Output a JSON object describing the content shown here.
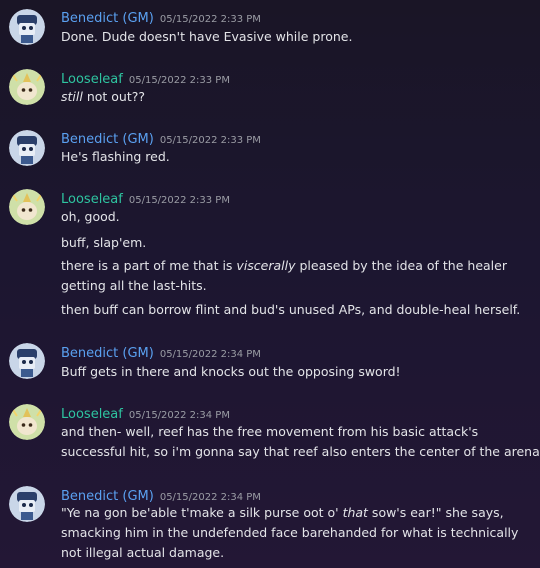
{
  "users": {
    "gm": {
      "name": "Benedict (GM)",
      "avatar": "robot-avatar-icon",
      "color": "#5aa0f0"
    },
    "leaf": {
      "name": "Looseleaf",
      "avatar": "leaf-creature-avatar-icon",
      "color": "#2ec4a0"
    }
  },
  "messages": [
    {
      "author": "Benedict (GM)",
      "time": "05/15/2022 2:33 PM",
      "lines": [
        "Done. Dude doesn't have Evasive while prone."
      ]
    },
    {
      "author": "Looseleaf",
      "time": "05/15/2022 2:33 PM",
      "lines": [
        "still not out??"
      ]
    },
    {
      "author": "Benedict (GM)",
      "time": "05/15/2022 2:33 PM",
      "lines": [
        "He's flashing red."
      ]
    },
    {
      "author": "Looseleaf",
      "time": "05/15/2022 2:33 PM",
      "lines": [
        "oh, good.",
        "buff, slap'em.",
        "there is a part of me that is viscerally pleased by the idea of the healer",
        "getting all the last-hits.",
        "then buff can borrow flint and bud's unused APs, and double-heal herself."
      ]
    },
    {
      "author": "Benedict (GM)",
      "time": "05/15/2022 2:34 PM",
      "lines": [
        "Buff gets in there and knocks out the opposing sword!"
      ]
    },
    {
      "author": "Looseleaf",
      "time": "05/15/2022 2:34 PM",
      "lines": [
        "and then- well, reef has the free movement from his basic attack's",
        "successful hit, so i'm gonna say that reef also enters the center of the arena."
      ]
    },
    {
      "author": "Benedict (GM)",
      "time": "05/15/2022 2:34 PM",
      "lines": [
        "\"Ye na gon be'able t'make a silk purse oot o' that sow's ear!\" she says,",
        "smacking him in the undefended face barehanded for what is technically",
        "not illegal actual damage."
      ]
    }
  ]
}
